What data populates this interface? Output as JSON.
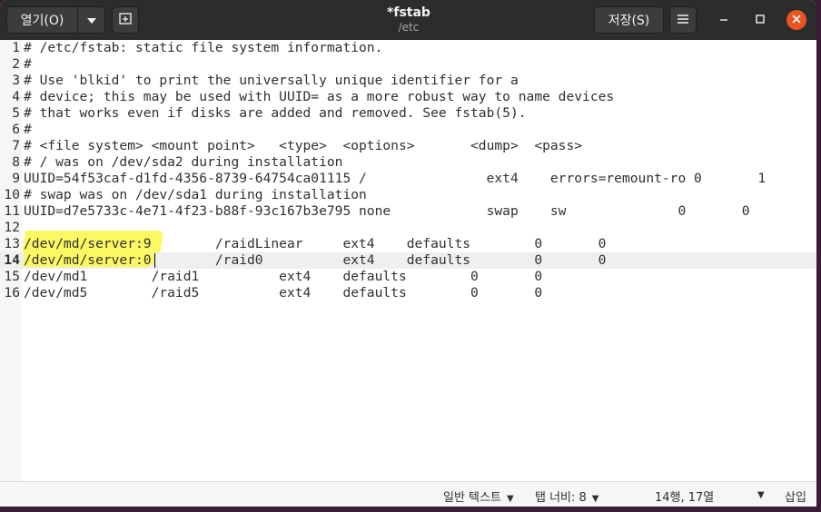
{
  "titlebar": {
    "open_label": "열기(O)",
    "title": "*fstab",
    "subtitle": "/etc",
    "save_label": "저장(S)"
  },
  "icons": {
    "dropdown": "chevron-down-icon",
    "new_tab": "new-tab-icon",
    "menu": "hamburger-menu-icon",
    "minimize": "minimize-icon",
    "maximize": "maximize-icon",
    "close": "close-icon"
  },
  "colors": {
    "titlebar": "#2c2c2c",
    "close_button": "#e95420",
    "highlight": "#fcf85a"
  },
  "editor": {
    "current_line": 14,
    "lines": [
      {
        "n": "1",
        "text": "# /etc/fstab: static file system information."
      },
      {
        "n": "2",
        "text": "#"
      },
      {
        "n": "3",
        "text": "# Use 'blkid' to print the universally unique identifier for a"
      },
      {
        "n": "4",
        "text": "# device; this may be used with UUID= as a more robust way to name devices"
      },
      {
        "n": "5",
        "text": "# that works even if disks are added and removed. See fstab(5)."
      },
      {
        "n": "6",
        "text": "#"
      },
      {
        "n": "7",
        "text": "# <file system> <mount point>   <type>  <options>       <dump>  <pass>"
      },
      {
        "n": "8",
        "text": "# / was on /dev/sda2 during installation"
      },
      {
        "n": "9",
        "text": "UUID=54f53caf-d1fd-4356-8739-64754ca01115 /               ext4    errors=remount-ro 0       1"
      },
      {
        "n": "10",
        "text": "# swap was on /dev/sda1 during installation"
      },
      {
        "n": "11",
        "text": "UUID=d7e5733c-4e71-4f23-b88f-93c167b3e795 none            swap    sw              0       0"
      },
      {
        "n": "12",
        "text": ""
      },
      {
        "n": "13",
        "text": "/dev/md/server:9        /raidLinear     ext4    defaults        0       0"
      },
      {
        "n": "14",
        "text": "/dev/md/server:0        /raid0          ext4    defaults        0       0"
      },
      {
        "n": "15",
        "text": "/dev/md1        /raid1          ext4    defaults        0       0"
      },
      {
        "n": "16",
        "text": "/dev/md5        /raid5          ext4    defaults        0       0"
      }
    ]
  },
  "statusbar": {
    "language": "일반 텍스트",
    "tab_width": "탭 너비: 8",
    "position": "14행, 17열",
    "mode": "삽입"
  }
}
